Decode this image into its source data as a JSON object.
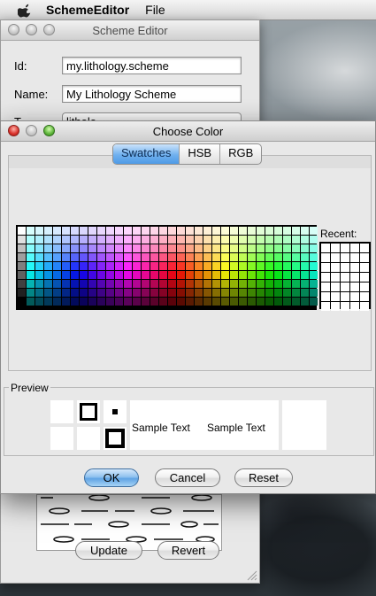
{
  "menubar": {
    "app_name": "SchemeEditor",
    "menu_file": "File"
  },
  "scheme_editor": {
    "title": "Scheme Editor",
    "id_label": "Id:",
    "id_value": "my.lithology.scheme",
    "name_label": "Name:",
    "name_value": "My Lithology Scheme",
    "type_label": "T",
    "type_value": "litholo",
    "update_label": "Update",
    "revert_label": "Revert"
  },
  "color_dialog": {
    "title": "Choose Color",
    "tabs": [
      "Swatches",
      "HSB",
      "RGB"
    ],
    "selected_tab": "Swatches",
    "recent_label": "Recent:",
    "preview_label": "Preview",
    "sample_text": "Sample Text",
    "ok_label": "OK",
    "cancel_label": "Cancel",
    "reset_label": "Reset"
  },
  "colors": {
    "accent": "#5fa3e4",
    "window_bg": "#e8e8e8"
  }
}
